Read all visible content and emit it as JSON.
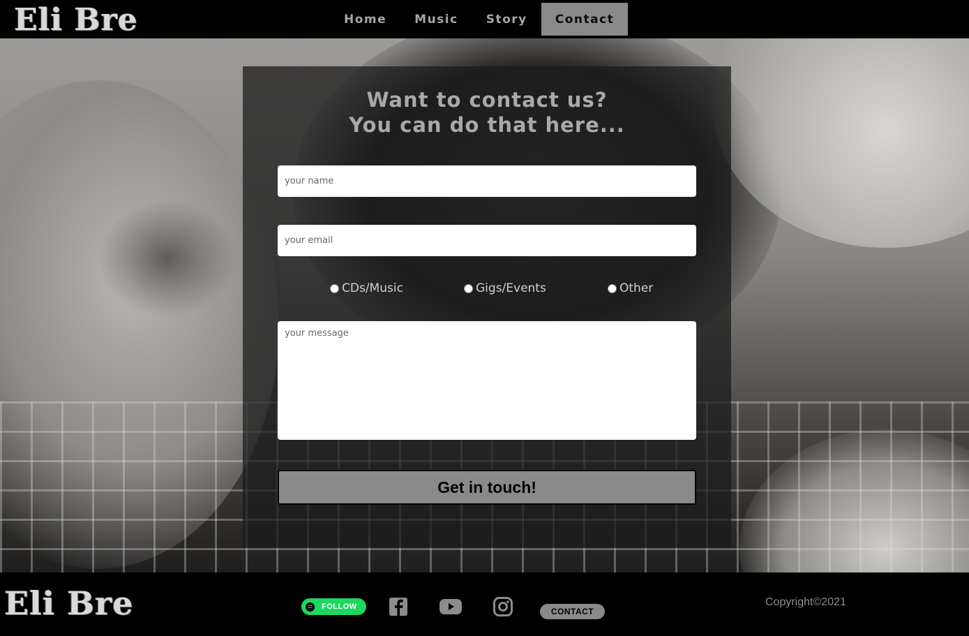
{
  "header": {
    "logo": "Eli Bre",
    "nav": [
      {
        "label": "Home"
      },
      {
        "label": "Music"
      },
      {
        "label": "Story"
      },
      {
        "label": "Contact"
      }
    ],
    "active_nav": "Contact"
  },
  "contact": {
    "title_line1": "Want to contact us?",
    "title_line2": "You can do that here...",
    "name_placeholder": "your name",
    "email_placeholder": "your email",
    "radios": [
      {
        "label": "CDs/Music",
        "checked": false
      },
      {
        "label": "Gigs/Events",
        "checked": false
      },
      {
        "label": "Other",
        "checked": false
      }
    ],
    "message_placeholder": "your message",
    "submit_label": "Get in touch!"
  },
  "footer": {
    "logo": "Eli Bre",
    "spotify_label": "FOLLOW",
    "social_icons": [
      "spotify-icon",
      "facebook-icon",
      "youtube-icon",
      "instagram-icon"
    ],
    "contact_label": "CONTACT",
    "copyright": "Copyright©2021"
  },
  "colors": {
    "nav_active_bg": "#8a8a8a",
    "spotify_green": "#1ed760",
    "panel_bg": "rgba(25,25,25,0.72)"
  }
}
